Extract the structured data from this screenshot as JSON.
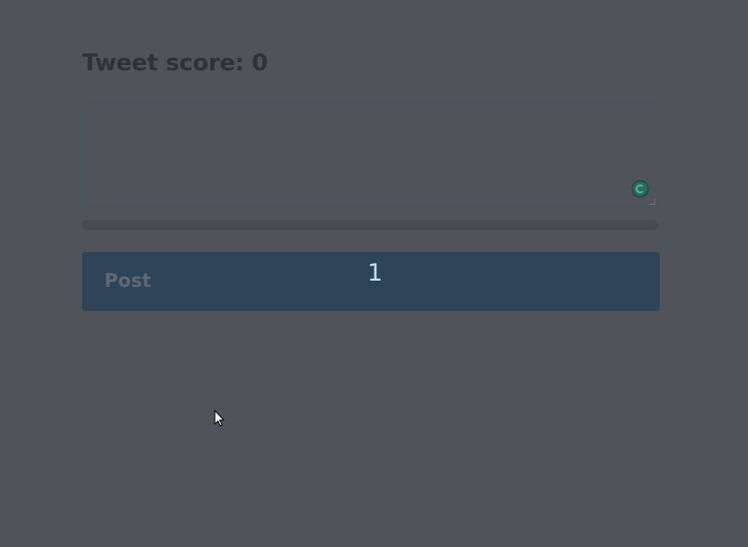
{
  "score": {
    "title": "Tweet score: 0"
  },
  "composer": {
    "value": "",
    "placeholder": "",
    "grammar_icon": "grammar-check-icon"
  },
  "progress": {
    "fraction": 0
  },
  "post": {
    "label": "Post",
    "count": "1"
  },
  "colors": {
    "background": "#50535a",
    "button": "#2e4459",
    "count_text": "#bfe3f5"
  }
}
